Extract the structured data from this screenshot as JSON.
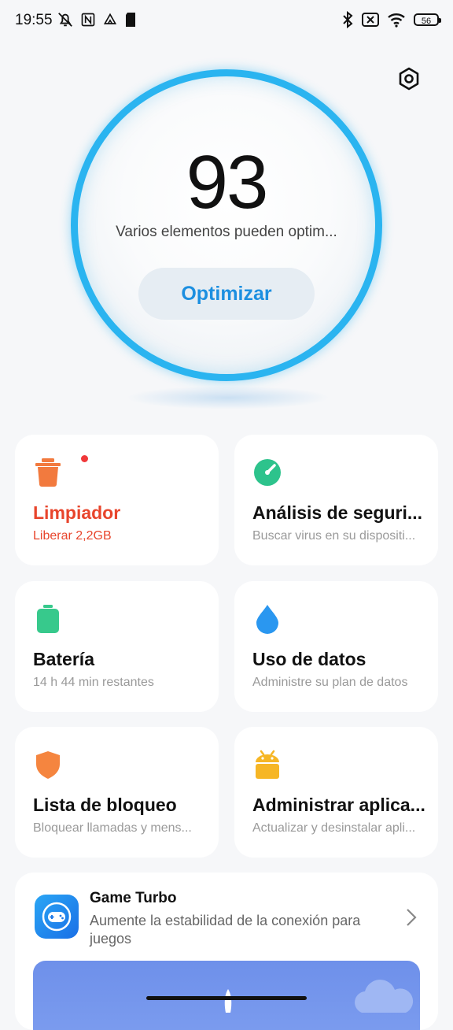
{
  "status_bar": {
    "time": "19:55",
    "battery_level": "56",
    "left_icons": [
      "mute-notifications-icon",
      "nfc-icon",
      "drive-icon",
      "sim-card-icon"
    ],
    "right_icons": [
      "bluetooth-icon",
      "no-sim-icon",
      "wifi-icon",
      "battery-icon"
    ]
  },
  "header": {
    "settings_icon": "settings-hexagon-icon"
  },
  "score": {
    "value": "93",
    "description": "Varios elementos pueden optim...",
    "button_label": "Optimizar",
    "ring_color": "#2ab4f0"
  },
  "cards": [
    {
      "title": "Limpiador",
      "subtitle": "Liberar 2,2GB",
      "icon": "trash-icon",
      "color": "#f27a3e",
      "alert_dot": true
    },
    {
      "title": "Análisis de seguri...",
      "subtitle": "Buscar virus en su dispositi...",
      "icon": "speedometer-icon",
      "color": "#2dc38c"
    },
    {
      "title": "Batería",
      "subtitle": "14 h 44 min  restantes",
      "icon": "battery-icon",
      "color": "#37c98c"
    },
    {
      "title": "Uso de datos",
      "subtitle": "Administre su plan de datos",
      "icon": "water-drop-icon",
      "color": "#2a97f0"
    },
    {
      "title": "Lista de bloqueo",
      "subtitle": "Bloquear llamadas y mens...",
      "icon": "shield-icon",
      "color": "#f5853f"
    },
    {
      "title": "Administrar aplica...",
      "subtitle": "Actualizar y desinstalar apli...",
      "icon": "android-icon",
      "color": "#f6b625"
    }
  ],
  "game_turbo": {
    "title": "Game Turbo",
    "description": "Aumente la estabilidad de la conexión para juegos",
    "icon": "gamepad-icon"
  }
}
